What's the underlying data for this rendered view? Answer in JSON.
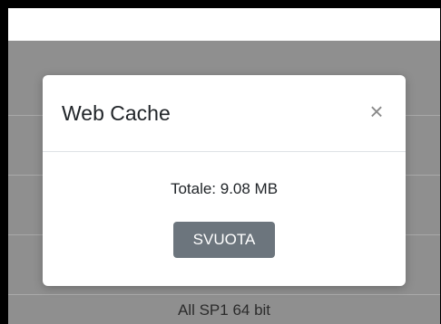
{
  "background": {
    "row_text": "All SP1 64 bit"
  },
  "modal": {
    "title": "Web Cache",
    "close_icon": "×",
    "total_text": "Totale: 9.08 MB",
    "empty_button_label": "SVUOTA"
  },
  "colors": {
    "backdrop": "#8f8f8f",
    "button": "#6c757d",
    "frame_border": "#000000"
  }
}
